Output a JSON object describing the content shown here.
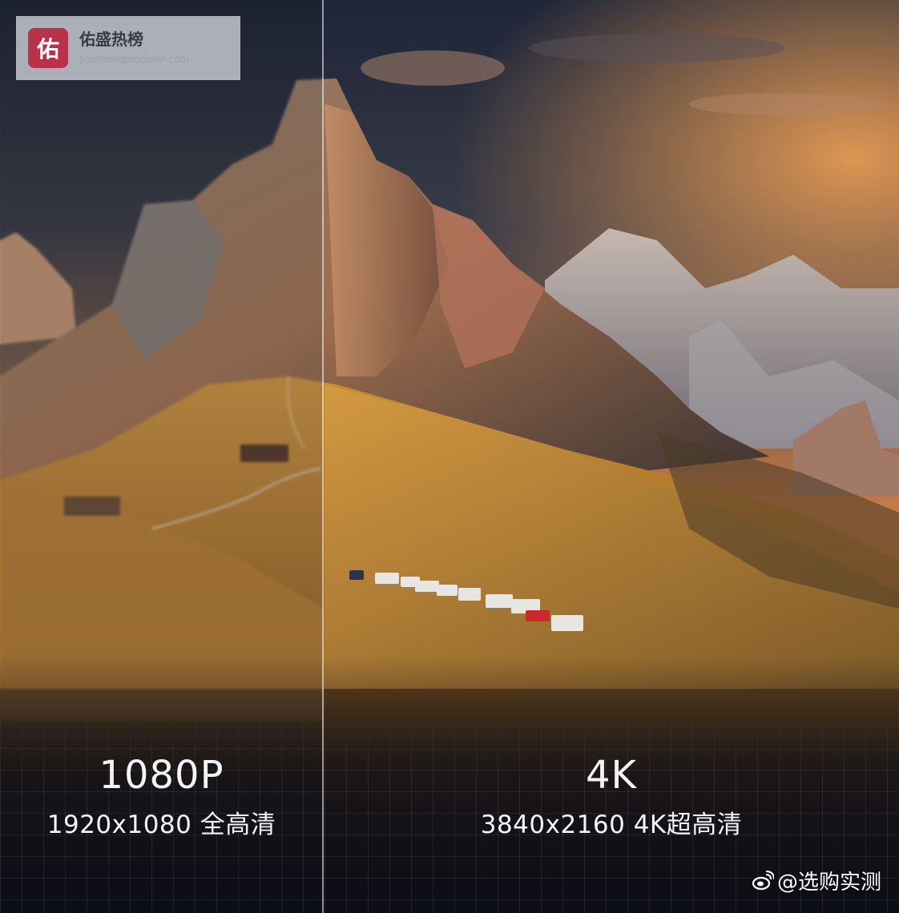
{
  "watermark": {
    "logo_char": "佑",
    "name": "佑盛热榜",
    "url": "youshengprecision.com"
  },
  "left": {
    "title": "1080P",
    "subtitle": "1920x1080 全高清"
  },
  "right": {
    "title": "4K",
    "subtitle": "3840x2160 4K超高清"
  },
  "credit": {
    "icon": "weibo-icon",
    "text": "@选购实测"
  },
  "colors": {
    "sky_top": "#20293f",
    "sunset": "#e58a3c",
    "meadow": "#b97a2a",
    "logo_bg": "#b83249"
  }
}
